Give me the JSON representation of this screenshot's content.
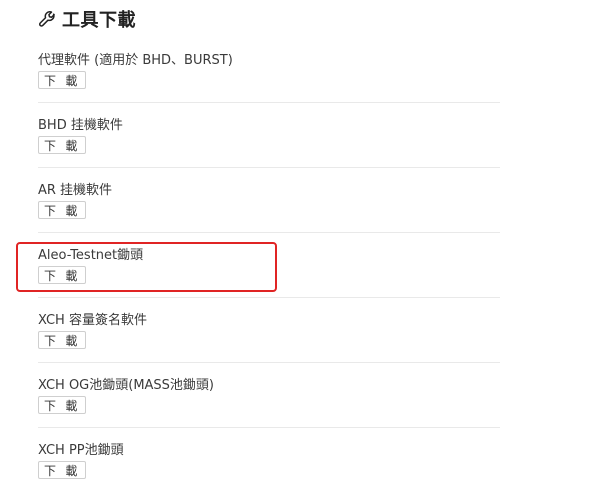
{
  "header": {
    "title": "工具下載",
    "icon": "wrench-icon"
  },
  "items": [
    {
      "name": "代理軟件 (適用於 BHD、BURST)",
      "button": "下 載"
    },
    {
      "name": "BHD 挂機軟件",
      "button": "下 載"
    },
    {
      "name": "AR 挂機軟件",
      "button": "下 載"
    },
    {
      "name": "Aleo-Testnet鋤頭",
      "button": "下 載"
    },
    {
      "name": "XCH 容量簽名軟件",
      "button": "下 載"
    },
    {
      "name": "XCH OG池鋤頭(MASS池鋤頭)",
      "button": "下 載"
    },
    {
      "name": "XCH PP池鋤頭",
      "button": "下 載"
    }
  ],
  "colors": {
    "highlight": "#e02424",
    "divider": "#e9e9e9"
  }
}
